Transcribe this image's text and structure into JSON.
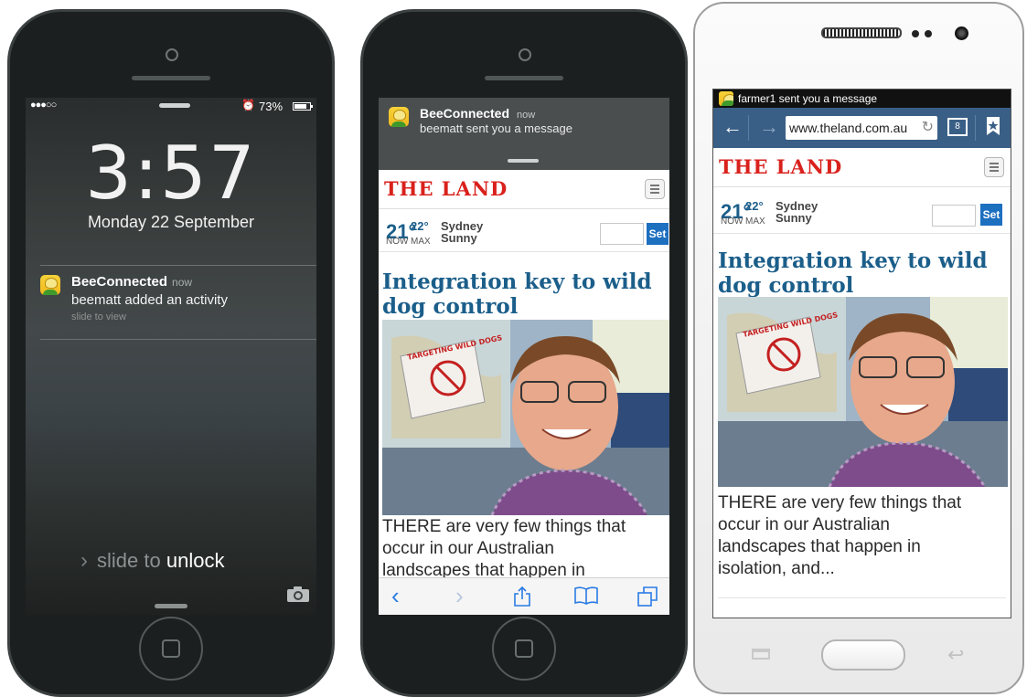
{
  "lock_phone": {
    "status": {
      "signal": "●●●○○",
      "battery": "73%"
    },
    "time": "3:57",
    "date": "Monday 22 September",
    "notification": {
      "app": "BeeConnected",
      "when": "now",
      "message": "beematt added an activity",
      "hint": "slide to view"
    },
    "slide_prefix": "slide to",
    "slide_word": "unlock"
  },
  "safari_phone": {
    "banner": {
      "app": "BeeConnected",
      "when": "now",
      "message": "beematt sent you a message"
    },
    "logo": "THE LAND",
    "weather": {
      "now_temp": "21°",
      "max_temp": "22°",
      "now_label": "NOW",
      "max_label": "MAX",
      "city": "Sydney",
      "condition": "Sunny",
      "set_label": "Set"
    },
    "headline_line1": "Integration key to wild",
    "headline_line2": "dog control",
    "poster_text": "TARGETING WILD DOGS",
    "lede": [
      "THERE are very few things that",
      "occur in our Australian",
      "landscapes that happen in"
    ]
  },
  "android_phone": {
    "status_message": "farmer1 sent you a message",
    "url": "www.theland.com.au",
    "tab_count": "8",
    "logo": "THE LAND",
    "weather": {
      "now_temp": "21°",
      "max_temp": "22°",
      "now_label": "NOW",
      "max_label": "MAX",
      "city": "Sydney",
      "condition": "Sunny",
      "set_label": "Set"
    },
    "headline_line1": "Integration key to wild",
    "headline_line2": "dog control",
    "poster_text": "TARGETING WILD DOGS",
    "lede": [
      "THERE are very few things that",
      "occur in our Australian",
      "landscapes that happen in",
      "isolation, and..."
    ]
  }
}
